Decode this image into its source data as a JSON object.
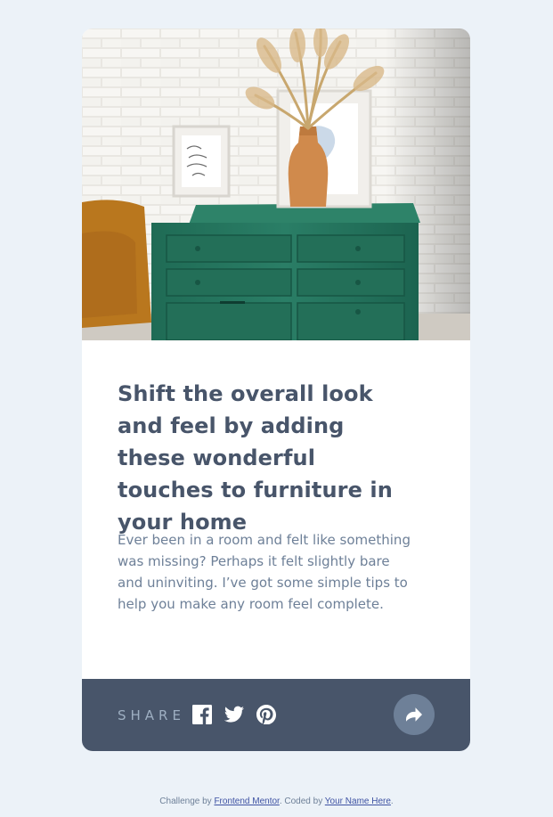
{
  "article": {
    "title": "Shift the overall look and feel by adding these wonderful touches to furniture in your home",
    "description": "Ever been in a room and felt like something was missing? Perhaps it felt slightly bare and uninviting. I’ve got some simple tips to help you make any room feel complete."
  },
  "share": {
    "label": "SHARE",
    "icons": [
      "facebook-icon",
      "twitter-icon",
      "pinterest-icon",
      "share-icon"
    ]
  },
  "attribution": {
    "prefix": "Challenge by ",
    "challenge_link": "Frontend Mentor",
    "middle": ". Coded by ",
    "author_link": "Your Name Here",
    "suffix": "."
  },
  "colors": {
    "page_background": "#ECF2F8",
    "card_background": "#FFFFFF",
    "title": "#48556A",
    "body_text": "#6E8098",
    "share_bar": "#48556A",
    "share_label": "#9EAFC2",
    "share_button": "#6E8098",
    "link": "#3E52A3"
  }
}
